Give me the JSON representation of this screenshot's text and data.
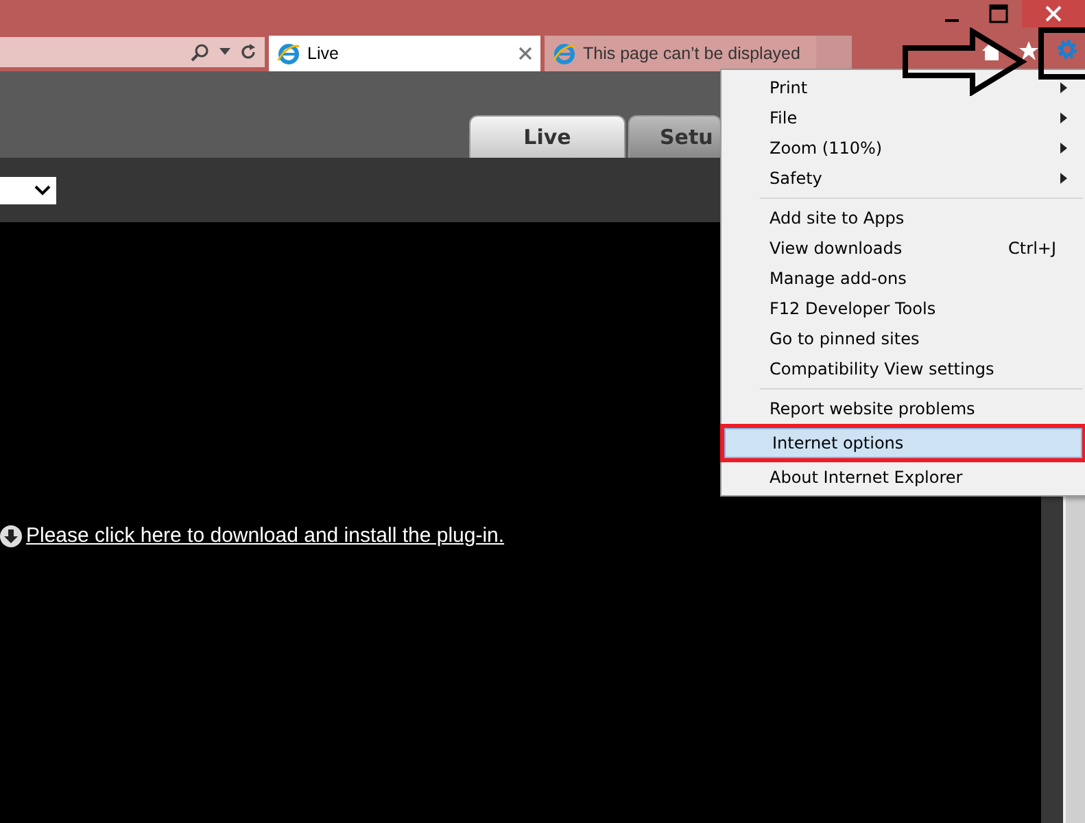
{
  "browser_tabs": [
    {
      "label": "Live",
      "selected": true,
      "closable": true
    },
    {
      "label": "This page can’t be displayed",
      "selected": false,
      "closable": false
    }
  ],
  "page_tabs": [
    {
      "label": "Live",
      "selected": true
    },
    {
      "label": "Setu",
      "selected": false
    }
  ],
  "plugin_link": "Please click here to download and install the plug-in.",
  "menu": [
    [
      {
        "label": "Print",
        "submenu": true,
        "selected": false
      },
      {
        "label": "File",
        "submenu": true,
        "selected": false
      },
      {
        "label": "Zoom (110%)",
        "submenu": true,
        "selected": false
      },
      {
        "label": "Safety",
        "submenu": true,
        "selected": false
      }
    ],
    [
      {
        "label": "Add site to Apps",
        "submenu": false,
        "selected": false
      },
      {
        "label": "View downloads",
        "shortcut": "Ctrl+J",
        "submenu": false,
        "selected": false
      },
      {
        "label": "Manage add-ons",
        "submenu": false,
        "selected": false
      },
      {
        "label": "F12 Developer Tools",
        "submenu": false,
        "selected": false
      },
      {
        "label": "Go to pinned sites",
        "submenu": false,
        "selected": false
      },
      {
        "label": "Compatibility View settings",
        "submenu": false,
        "selected": false
      }
    ],
    [
      {
        "label": "Report website problems",
        "submenu": false,
        "selected": false
      },
      {
        "label": "Internet options",
        "submenu": false,
        "selected": true,
        "highlighted": true
      },
      {
        "label": "About Internet Explorer",
        "submenu": false,
        "selected": false
      }
    ]
  ]
}
